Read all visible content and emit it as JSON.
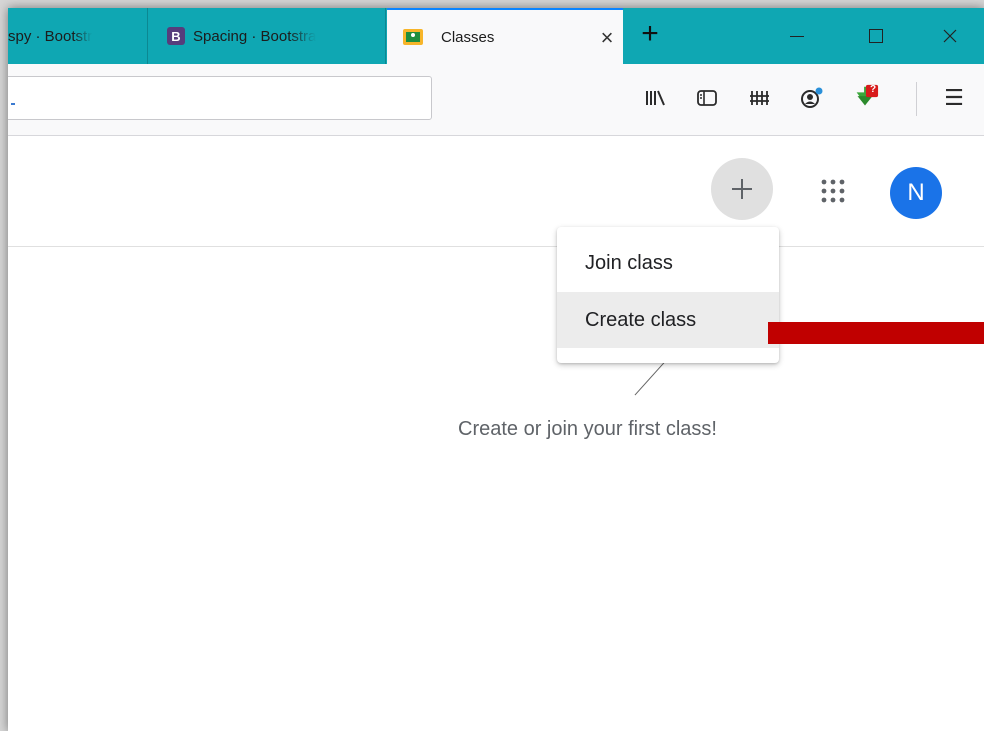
{
  "browser": {
    "tabs": [
      {
        "title": "spy · Bootstr",
        "active": false
      },
      {
        "title": "Spacing · Bootstra",
        "favicon_letter": "B",
        "active": false
      },
      {
        "title": "Classes",
        "active": true
      }
    ],
    "tab_close_glyph": "×",
    "new_tab_glyph": "+",
    "window_close_glyph": "✕",
    "download_badge": "?"
  },
  "toolbar": {
    "menu_glyph": "☰"
  },
  "app": {
    "add_glyph": "+",
    "avatar_initial": "N",
    "menu": {
      "join_label": "Join class",
      "create_label": "Create class"
    },
    "empty_message": "Create or join your first class!"
  },
  "colors": {
    "tabbar": "#0fa7b3",
    "avatar": "#1a73e8",
    "annotation": "#c00000"
  }
}
